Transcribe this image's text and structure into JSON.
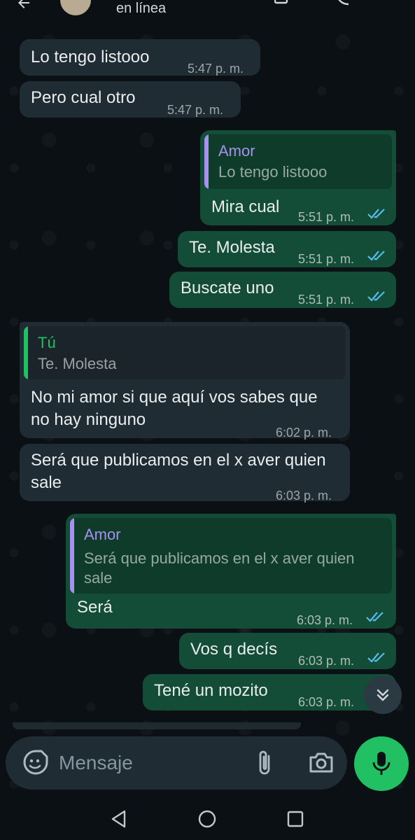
{
  "header": {
    "status": "en línea"
  },
  "messages": [
    {
      "id": "m1",
      "dir": "in",
      "text": "Lo tengo listooo",
      "time": "5:47 p. m."
    },
    {
      "id": "m2",
      "dir": "in",
      "text": "Pero cual otro",
      "time": "5:47 p. m."
    },
    {
      "id": "m3",
      "dir": "out",
      "quote": {
        "author": "Amor",
        "text": "Lo tengo listooo"
      },
      "text": "Mira cual",
      "time": "5:51 p. m.",
      "read": true
    },
    {
      "id": "m4",
      "dir": "out",
      "text": "Te. Molesta",
      "time": "5:51 p. m.",
      "read": true
    },
    {
      "id": "m5",
      "dir": "out",
      "text": "Buscate uno",
      "time": "5:51 p. m.",
      "read": true
    },
    {
      "id": "m6",
      "dir": "in",
      "quote": {
        "author": "Tú",
        "text": "Te. Molesta"
      },
      "text": "No mi amor si que aquí vos sabes que no hay ninguno",
      "time": "6:02 p. m."
    },
    {
      "id": "m7",
      "dir": "in",
      "text": "Será que publicamos en el x aver quien sale",
      "time": "6:03 p. m."
    },
    {
      "id": "m8",
      "dir": "out",
      "quote": {
        "author": "Amor",
        "text": "Será que publicamos en el x aver quien sale"
      },
      "text": "Será",
      "time": "6:03 p. m.",
      "read": true
    },
    {
      "id": "m9",
      "dir": "out",
      "text": "Vos q decís",
      "time": "6:03 p. m.",
      "read": true
    },
    {
      "id": "m10",
      "dir": "out",
      "text": "Tené un mozito",
      "time": "6:03 p. m.",
      "read": true
    }
  ],
  "composer": {
    "placeholder": "Mensaje"
  },
  "colors": {
    "background": "#0b1014",
    "incoming_bubble": "#202c33",
    "outgoing_bubble": "#144d37",
    "tick_read": "#53bdeb",
    "quote_amor": "#a791f0",
    "quote_tu": "#21c063",
    "mic_button": "#21c063"
  },
  "icons": {
    "back": "arrow-left-icon",
    "emoji": "emoji-sticker-icon",
    "attach": "paperclip-icon",
    "camera": "camera-icon",
    "mic": "microphone-icon",
    "scroll_down": "double-chevron-down-icon",
    "read_receipt": "double-check-icon"
  }
}
